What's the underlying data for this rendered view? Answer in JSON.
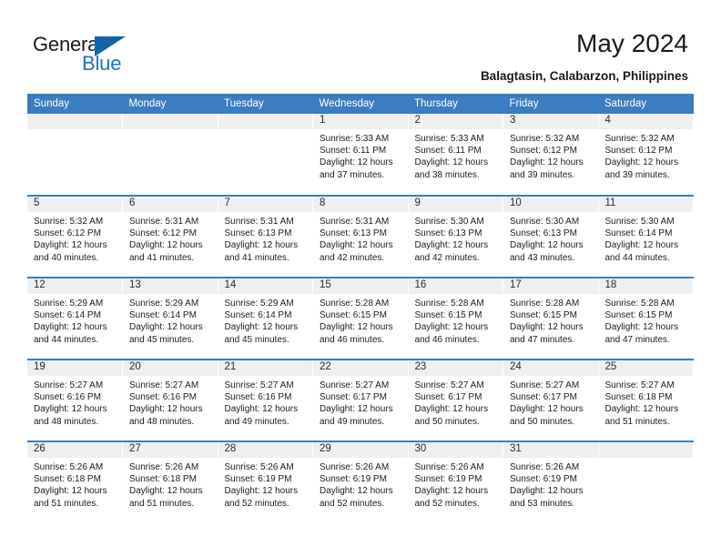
{
  "brand": {
    "name_top": "General",
    "name_bottom": "Blue",
    "accent_color": "#1a73c4",
    "triangle_color": "#1464aa"
  },
  "header": {
    "title": "May 2024",
    "subtitle": "Balagtasin, Calabarzon, Philippines"
  },
  "calendar": {
    "header_bg": "#3b7dc0",
    "daynum_bg": "#efefef",
    "weekday_labels": [
      "Sunday",
      "Monday",
      "Tuesday",
      "Wednesday",
      "Thursday",
      "Friday",
      "Saturday"
    ],
    "weeks": [
      [
        {
          "day": "",
          "lines": []
        },
        {
          "day": "",
          "lines": []
        },
        {
          "day": "",
          "lines": []
        },
        {
          "day": "1",
          "lines": [
            "Sunrise: 5:33 AM",
            "Sunset: 6:11 PM",
            "Daylight: 12 hours",
            "and 37 minutes."
          ]
        },
        {
          "day": "2",
          "lines": [
            "Sunrise: 5:33 AM",
            "Sunset: 6:11 PM",
            "Daylight: 12 hours",
            "and 38 minutes."
          ]
        },
        {
          "day": "3",
          "lines": [
            "Sunrise: 5:32 AM",
            "Sunset: 6:12 PM",
            "Daylight: 12 hours",
            "and 39 minutes."
          ]
        },
        {
          "day": "4",
          "lines": [
            "Sunrise: 5:32 AM",
            "Sunset: 6:12 PM",
            "Daylight: 12 hours",
            "and 39 minutes."
          ]
        }
      ],
      [
        {
          "day": "5",
          "lines": [
            "Sunrise: 5:32 AM",
            "Sunset: 6:12 PM",
            "Daylight: 12 hours",
            "and 40 minutes."
          ]
        },
        {
          "day": "6",
          "lines": [
            "Sunrise: 5:31 AM",
            "Sunset: 6:12 PM",
            "Daylight: 12 hours",
            "and 41 minutes."
          ]
        },
        {
          "day": "7",
          "lines": [
            "Sunrise: 5:31 AM",
            "Sunset: 6:13 PM",
            "Daylight: 12 hours",
            "and 41 minutes."
          ]
        },
        {
          "day": "8",
          "lines": [
            "Sunrise: 5:31 AM",
            "Sunset: 6:13 PM",
            "Daylight: 12 hours",
            "and 42 minutes."
          ]
        },
        {
          "day": "9",
          "lines": [
            "Sunrise: 5:30 AM",
            "Sunset: 6:13 PM",
            "Daylight: 12 hours",
            "and 42 minutes."
          ]
        },
        {
          "day": "10",
          "lines": [
            "Sunrise: 5:30 AM",
            "Sunset: 6:13 PM",
            "Daylight: 12 hours",
            "and 43 minutes."
          ]
        },
        {
          "day": "11",
          "lines": [
            "Sunrise: 5:30 AM",
            "Sunset: 6:14 PM",
            "Daylight: 12 hours",
            "and 44 minutes."
          ]
        }
      ],
      [
        {
          "day": "12",
          "lines": [
            "Sunrise: 5:29 AM",
            "Sunset: 6:14 PM",
            "Daylight: 12 hours",
            "and 44 minutes."
          ]
        },
        {
          "day": "13",
          "lines": [
            "Sunrise: 5:29 AM",
            "Sunset: 6:14 PM",
            "Daylight: 12 hours",
            "and 45 minutes."
          ]
        },
        {
          "day": "14",
          "lines": [
            "Sunrise: 5:29 AM",
            "Sunset: 6:14 PM",
            "Daylight: 12 hours",
            "and 45 minutes."
          ]
        },
        {
          "day": "15",
          "lines": [
            "Sunrise: 5:28 AM",
            "Sunset: 6:15 PM",
            "Daylight: 12 hours",
            "and 46 minutes."
          ]
        },
        {
          "day": "16",
          "lines": [
            "Sunrise: 5:28 AM",
            "Sunset: 6:15 PM",
            "Daylight: 12 hours",
            "and 46 minutes."
          ]
        },
        {
          "day": "17",
          "lines": [
            "Sunrise: 5:28 AM",
            "Sunset: 6:15 PM",
            "Daylight: 12 hours",
            "and 47 minutes."
          ]
        },
        {
          "day": "18",
          "lines": [
            "Sunrise: 5:28 AM",
            "Sunset: 6:15 PM",
            "Daylight: 12 hours",
            "and 47 minutes."
          ]
        }
      ],
      [
        {
          "day": "19",
          "lines": [
            "Sunrise: 5:27 AM",
            "Sunset: 6:16 PM",
            "Daylight: 12 hours",
            "and 48 minutes."
          ]
        },
        {
          "day": "20",
          "lines": [
            "Sunrise: 5:27 AM",
            "Sunset: 6:16 PM",
            "Daylight: 12 hours",
            "and 48 minutes."
          ]
        },
        {
          "day": "21",
          "lines": [
            "Sunrise: 5:27 AM",
            "Sunset: 6:16 PM",
            "Daylight: 12 hours",
            "and 49 minutes."
          ]
        },
        {
          "day": "22",
          "lines": [
            "Sunrise: 5:27 AM",
            "Sunset: 6:17 PM",
            "Daylight: 12 hours",
            "and 49 minutes."
          ]
        },
        {
          "day": "23",
          "lines": [
            "Sunrise: 5:27 AM",
            "Sunset: 6:17 PM",
            "Daylight: 12 hours",
            "and 50 minutes."
          ]
        },
        {
          "day": "24",
          "lines": [
            "Sunrise: 5:27 AM",
            "Sunset: 6:17 PM",
            "Daylight: 12 hours",
            "and 50 minutes."
          ]
        },
        {
          "day": "25",
          "lines": [
            "Sunrise: 5:27 AM",
            "Sunset: 6:18 PM",
            "Daylight: 12 hours",
            "and 51 minutes."
          ]
        }
      ],
      [
        {
          "day": "26",
          "lines": [
            "Sunrise: 5:26 AM",
            "Sunset: 6:18 PM",
            "Daylight: 12 hours",
            "and 51 minutes."
          ]
        },
        {
          "day": "27",
          "lines": [
            "Sunrise: 5:26 AM",
            "Sunset: 6:18 PM",
            "Daylight: 12 hours",
            "and 51 minutes."
          ]
        },
        {
          "day": "28",
          "lines": [
            "Sunrise: 5:26 AM",
            "Sunset: 6:19 PM",
            "Daylight: 12 hours",
            "and 52 minutes."
          ]
        },
        {
          "day": "29",
          "lines": [
            "Sunrise: 5:26 AM",
            "Sunset: 6:19 PM",
            "Daylight: 12 hours",
            "and 52 minutes."
          ]
        },
        {
          "day": "30",
          "lines": [
            "Sunrise: 5:26 AM",
            "Sunset: 6:19 PM",
            "Daylight: 12 hours",
            "and 52 minutes."
          ]
        },
        {
          "day": "31",
          "lines": [
            "Sunrise: 5:26 AM",
            "Sunset: 6:19 PM",
            "Daylight: 12 hours",
            "and 53 minutes."
          ]
        },
        {
          "day": "",
          "lines": []
        }
      ]
    ]
  }
}
